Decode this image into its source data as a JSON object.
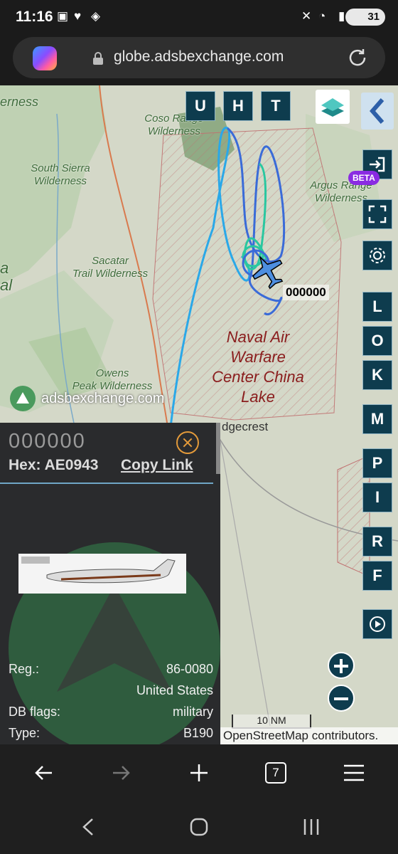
{
  "status_bar": {
    "time": "11:16",
    "battery": "31"
  },
  "browser": {
    "url": "globe.adsbexchange.com",
    "tabs_count": "7"
  },
  "map": {
    "labels": {
      "coso": "Coso Range\nWilderness",
      "south_sierra": "South Sierra\nWilderness",
      "argus": "Argus Range\nWilderness",
      "sacatar": "Sacatar\nTrail Wilderness",
      "owens": "Owens\nPeak Wilderness",
      "naval": "Naval Air Warfare Center China Lake",
      "city": "dgecrest",
      "left_cut_1": "a",
      "left_cut_2": "al",
      "left_cut_top": "erness"
    },
    "watermark": "adsbexchange.com",
    "aircraft_label": "000000",
    "scale": "10 NM",
    "attribution": "OpenStreetMap contributors.",
    "top_buttons": [
      "U",
      "H",
      "T"
    ],
    "side_buttons": [
      "L",
      "O",
      "K",
      "M",
      "P",
      "I",
      "R",
      "F"
    ],
    "beta_badge": "BETA",
    "colors": {
      "track_light_blue": "#2aa8e8",
      "track_blue": "#3a6bd8",
      "track_teal": "#29c7a0",
      "button_bg": "#0e3c4e",
      "restricted_area": "#c07070"
    }
  },
  "panel": {
    "callsign": "000000",
    "hex_label": "Hex:",
    "hex_value": "AE0943",
    "copy_link": "Copy Link",
    "rows": [
      {
        "key": "Reg.:",
        "value": "86-0080"
      },
      {
        "key": "",
        "value": "United States"
      },
      {
        "key": "DB flags:",
        "value": "military"
      },
      {
        "key": "Type:",
        "value": "B190"
      }
    ]
  }
}
